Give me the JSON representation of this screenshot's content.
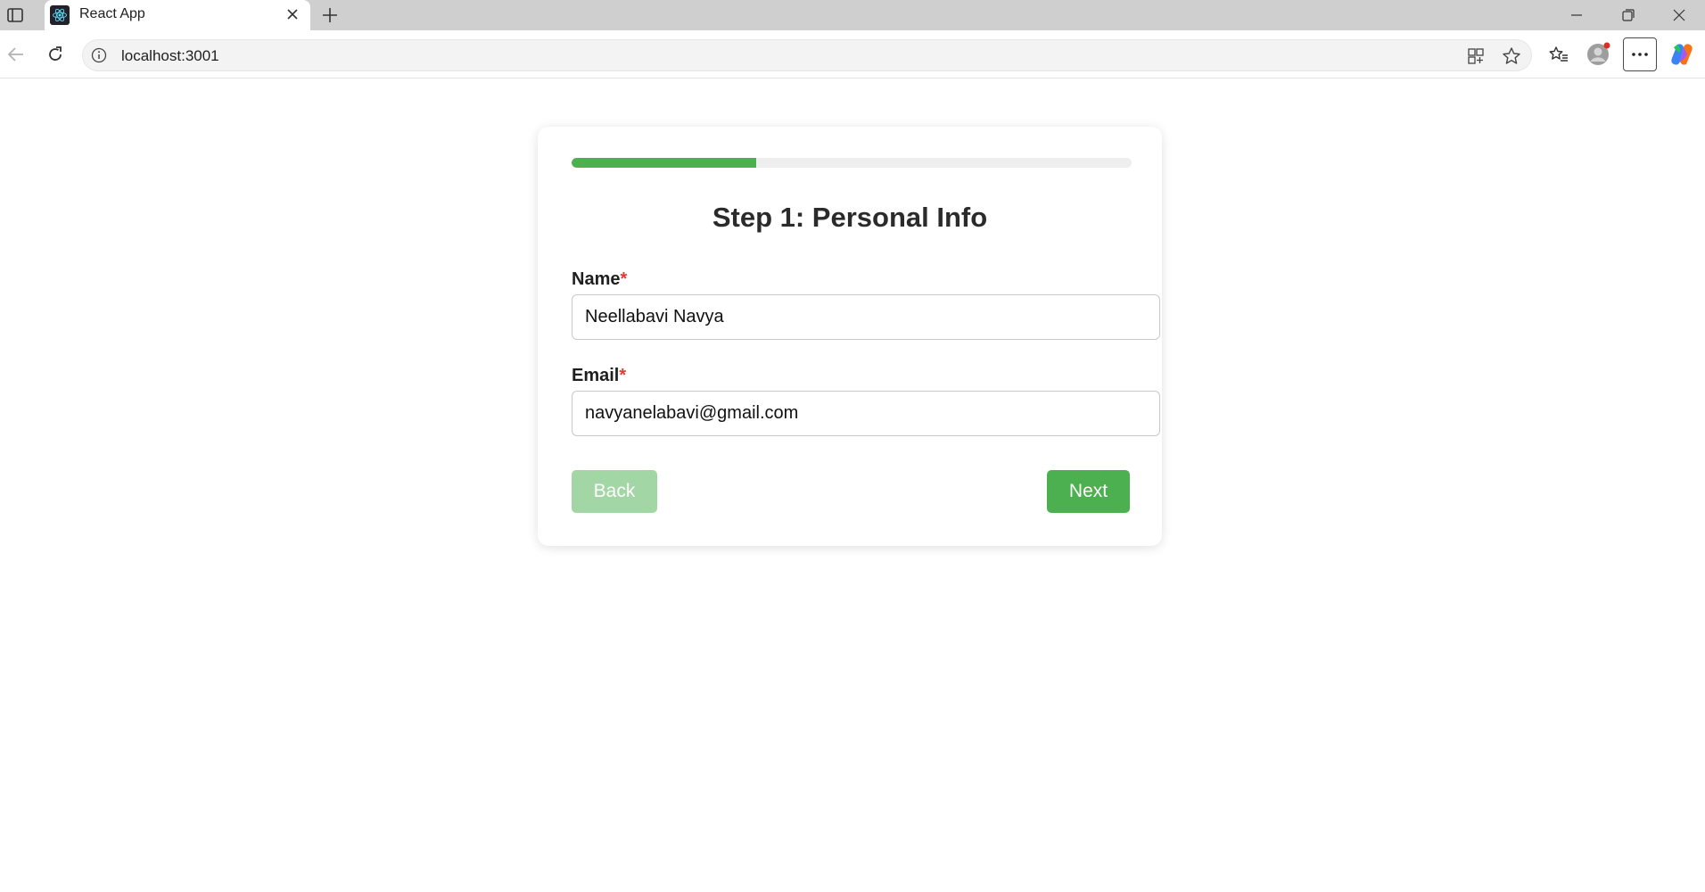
{
  "browser": {
    "tab_title": "React App",
    "url": "localhost:3001"
  },
  "form": {
    "progress_percent": 33,
    "title": "Step 1: Personal Info",
    "name": {
      "label": "Name",
      "required_mark": "*",
      "value": "Neellabavi Navya"
    },
    "email": {
      "label": "Email",
      "required_mark": "*",
      "value": "navyanelabavi@gmail.com"
    },
    "back_label": "Back",
    "next_label": "Next"
  },
  "colors": {
    "primary": "#4caf50",
    "primary_disabled": "#a3d6a5",
    "required": "#e53935",
    "track": "#eeeeee"
  }
}
